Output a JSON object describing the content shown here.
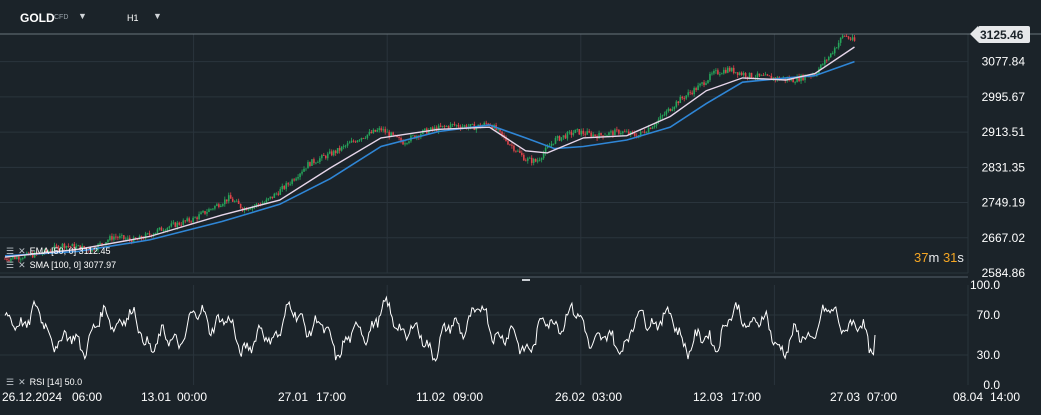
{
  "header": {
    "symbol": "GOLD",
    "symbol_type": "CFD",
    "timeframe": "H1"
  },
  "indicators": {
    "ema": "EMA [50, 0] 3112.45",
    "sma": "SMA [100, 0] 3077.97",
    "rsi": "RSI [14] 50.0"
  },
  "countdown": {
    "minutes": "37",
    "minutes_unit": "m",
    "seconds": "31",
    "seconds_unit": "s"
  },
  "colors": {
    "background": "#1b2329",
    "grid": "#2a343c",
    "candle_up": "#26a65b",
    "candle_down": "#e0434a",
    "ema": "#e6d6ea",
    "sma": "#2f86d6",
    "rsi": "#ffffff",
    "countdown": "#f5a623"
  },
  "chart_data": [
    {
      "type": "candlestick",
      "title": "GOLD H1",
      "last_price": "3125.46",
      "y_tick_labels": [
        "3077.84",
        "2995.67",
        "2913.51",
        "2831.35",
        "2749.19",
        "2667.02",
        "2584.86"
      ],
      "ylim": [
        2584.86,
        3140
      ],
      "x_tick_labels": [
        "26.12.2024",
        "06:00",
        "13.01",
        "00:00",
        "27.01",
        "17:00",
        "11.02",
        "09:00",
        "26.02",
        "03:00",
        "12.03",
        "17:00",
        "27.03",
        "07:00",
        "08.04",
        "14:00"
      ],
      "price_path": [
        [
          0,
          2618
        ],
        [
          0.05,
          2630
        ],
        [
          0.08,
          2650
        ],
        [
          0.12,
          2640
        ],
        [
          0.15,
          2670
        ],
        [
          0.18,
          2660
        ],
        [
          0.22,
          2690
        ],
        [
          0.26,
          2710
        ],
        [
          0.29,
          2740
        ],
        [
          0.31,
          2760
        ],
        [
          0.33,
          2735
        ],
        [
          0.36,
          2750
        ],
        [
          0.39,
          2790
        ],
        [
          0.42,
          2840
        ],
        [
          0.46,
          2870
        ],
        [
          0.49,
          2900
        ],
        [
          0.52,
          2920
        ],
        [
          0.55,
          2890
        ],
        [
          0.58,
          2915
        ],
        [
          0.62,
          2930
        ],
        [
          0.65,
          2925
        ],
        [
          0.67,
          2935
        ],
        [
          0.69,
          2900
        ],
        [
          0.72,
          2850
        ],
        [
          0.735,
          2845
        ],
        [
          0.76,
          2895
        ],
        [
          0.79,
          2915
        ],
        [
          0.82,
          2905
        ],
        [
          0.85,
          2915
        ],
        [
          0.875,
          2905
        ],
        [
          0.9,
          2935
        ],
        [
          0.93,
          2985
        ],
        [
          0.96,
          3020
        ],
        [
          0.98,
          3050
        ],
        [
          1.0,
          3060
        ],
        [
          1.03,
          3045
        ],
        [
          1.06,
          3040
        ],
        [
          1.09,
          3035
        ],
        [
          1.12,
          3050
        ],
        [
          1.14,
          3090
        ],
        [
          1.16,
          3140
        ],
        [
          1.175,
          3125
        ]
      ],
      "ema_path": [
        [
          0,
          2622
        ],
        [
          0.1,
          2640
        ],
        [
          0.2,
          2670
        ],
        [
          0.3,
          2720
        ],
        [
          0.38,
          2755
        ],
        [
          0.45,
          2830
        ],
        [
          0.52,
          2900
        ],
        [
          0.6,
          2920
        ],
        [
          0.67,
          2925
        ],
        [
          0.72,
          2870
        ],
        [
          0.75,
          2865
        ],
        [
          0.8,
          2900
        ],
        [
          0.86,
          2905
        ],
        [
          0.92,
          2950
        ],
        [
          0.97,
          3010
        ],
        [
          1.02,
          3040
        ],
        [
          1.08,
          3035
        ],
        [
          1.12,
          3050
        ],
        [
          1.175,
          3112
        ]
      ],
      "sma_path": [
        [
          0,
          2625
        ],
        [
          0.1,
          2635
        ],
        [
          0.2,
          2662
        ],
        [
          0.3,
          2705
        ],
        [
          0.38,
          2745
        ],
        [
          0.45,
          2805
        ],
        [
          0.52,
          2880
        ],
        [
          0.6,
          2915
        ],
        [
          0.67,
          2930
        ],
        [
          0.72,
          2900
        ],
        [
          0.76,
          2875
        ],
        [
          0.8,
          2880
        ],
        [
          0.86,
          2895
        ],
        [
          0.92,
          2925
        ],
        [
          0.97,
          2980
        ],
        [
          1.02,
          3030
        ],
        [
          1.08,
          3040
        ],
        [
          1.12,
          3045
        ],
        [
          1.175,
          3078
        ]
      ]
    },
    {
      "type": "line",
      "title": "RSI [14]",
      "y_tick_labels": [
        "100.0",
        "70.0",
        "30.0",
        "0.0"
      ],
      "ylim": [
        0,
        100
      ],
      "last_value": 50.0
    }
  ]
}
